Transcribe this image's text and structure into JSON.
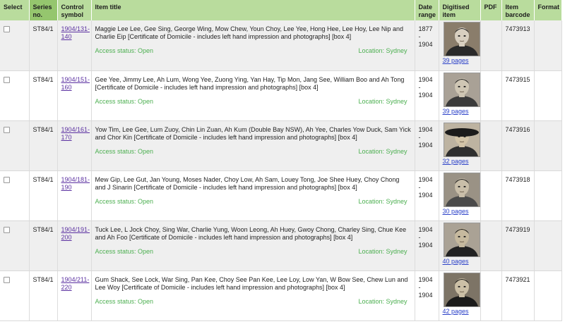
{
  "headers": {
    "select": "Select",
    "series": "Series no.",
    "control": "Control symbol",
    "title": "Item title",
    "date": "Date range",
    "digitised": "Digitised item",
    "pdf": "PDF",
    "barcode": "Item barcode",
    "format": "Format"
  },
  "access_label": "Access status: Open",
  "location_label": "Location: Sydney",
  "rows": [
    {
      "series": "ST84/1",
      "control_a": "1904/131-",
      "control_b": "140",
      "title": "Maggie Lee Lee, Gee Sing, George Wing, Mow Chew, Youn Choy, Lee Yee, Hong Hee, Lee Hoy, Lee Nip and Charlie Eip [Certificate of Domicile - includes left hand impression and photographs] [box 4]",
      "date_a": "1877 -",
      "date_b": "1904",
      "pages": "39 pages",
      "barcode": "7473913"
    },
    {
      "series": "ST84/1",
      "control_a": "1904/151-",
      "control_b": "160",
      "title": "Gee Yee, Jimmy Lee, Ah Lum, Wong Yee, Zuong Ying, Yan Hay, Tip Mon, Jang See, William Boo and Ah Tong [Certificate of Domicile - includes left hand impression and photographs] [box 4]",
      "date_a": "1904 -",
      "date_b": "1904",
      "pages": "39 pages",
      "barcode": "7473915"
    },
    {
      "series": "ST84/1",
      "control_a": "1904/161-",
      "control_b": "170",
      "title": "Yow Tim, Lee Gee, Lum Zuoy, Chin Lin Zuan, Ah Kum (Double Bay NSW), Ah Yee, Charles Yow Duck, Sam Yick and Chor Kin [Certificate of Domicile - includes left hand impression and photographs] [box 4]",
      "date_a": "1904 -",
      "date_b": "1904",
      "pages": "32 pages",
      "barcode": "7473916"
    },
    {
      "series": "ST84/1",
      "control_a": "1904/181-",
      "control_b": "190",
      "title": "Mew Gip, Lee Gut, Jan Young, Moses Nader, Choy Low, Ah Sam, Louey Tong, Joe Shee Huey, Choy Chong and J Sinarin [Certificate of Domicile - includes left hand impression and photographs] [box 4]",
      "date_a": "1904 -",
      "date_b": "1904",
      "pages": "30 pages",
      "barcode": "7473918"
    },
    {
      "series": "ST84/1",
      "control_a": "1904/191-",
      "control_b": "200",
      "title": "Tuck Lee, L Jock Choy, Sing War, Charlie Yung, Woon Leong, Ah Huey, Gwoy Chong, Charley Sing, Chue Kee and Ah Foo [Certificate of Domicile - includes left hand impression and photographs] [box 4]",
      "date_a": "1904 -",
      "date_b": "1904",
      "pages": "40 pages",
      "barcode": "7473919"
    },
    {
      "series": "ST84/1",
      "control_a": "1904/211-",
      "control_b": "220",
      "title": "Gum Shack, See Lock, War Sing, Pan Kee, Choy See Pan Kee, Lee Loy, Low Yan, W Bow See, Chew Lun and Lee Woy [Certificate of Domicile - includes left hand impression and photographs] [box 4]",
      "date_a": "1904 -",
      "date_b": "1904",
      "pages": "42 pages",
      "barcode": "7473921"
    }
  ]
}
